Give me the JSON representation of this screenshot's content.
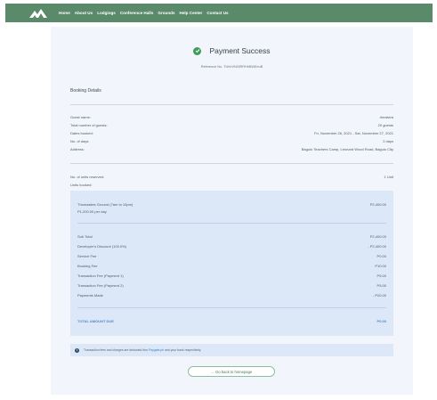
{
  "nav": {
    "items": [
      "Home",
      "About Us",
      "Lodgings",
      "Conference Halls",
      "Grounds",
      "Help Center",
      "Contact Us"
    ]
  },
  "header": {
    "title": "Payment Success",
    "reference": "Reference No. TUhhVNGiRRHhBWEeuB"
  },
  "details": {
    "section_title": "Booking Details",
    "rows": [
      {
        "label": "Guest name:",
        "value": "rhealvira"
      },
      {
        "label": "Total number of guests:",
        "value": "20 guests"
      },
      {
        "label": "Dates booked:",
        "value": "Fri, November 26, 2021 - Sat, November 27, 2021"
      },
      {
        "label": "No. of days:",
        "value": "2 days"
      },
      {
        "label": "Address:",
        "value": "Baguio Teachers Camp, Leonard Wood Road, Baguio City"
      }
    ],
    "units_reserved_label": "No. of units reserved:",
    "units_reserved_value": "1 Unit",
    "units_booked_label": "Units booked:"
  },
  "summary": {
    "unit_name": "Thomasites Ground (7am to 10pm)",
    "unit_rate": "P1,200.00 per day",
    "unit_amount": "P2,400.00",
    "lines": [
      {
        "label": "Sub Total",
        "value": "P2,400.00"
      },
      {
        "label": "Developer's Discount (100.0%)",
        "value": "- P2,400.00"
      },
      {
        "label": "Service Fee",
        "value": "P0.00"
      },
      {
        "label": "Booking Fee",
        "value": "P10.00"
      },
      {
        "label": "Transaction Fee (Payment 1)",
        "value": "P5.00"
      },
      {
        "label": "Transaction Fee (Payment 2)",
        "value": "P5.00"
      },
      {
        "label": "Payments Made",
        "value": "- P20.00"
      }
    ],
    "total_label": "TOTAL AMOUNT DUE",
    "total_value": "P0.00"
  },
  "notice": {
    "text_before": "Transaction fees and charges are deducted thru",
    "link": "Paygate.ph",
    "text_after": "and your bank respectively."
  },
  "back_button": "← Go back to homepage"
}
